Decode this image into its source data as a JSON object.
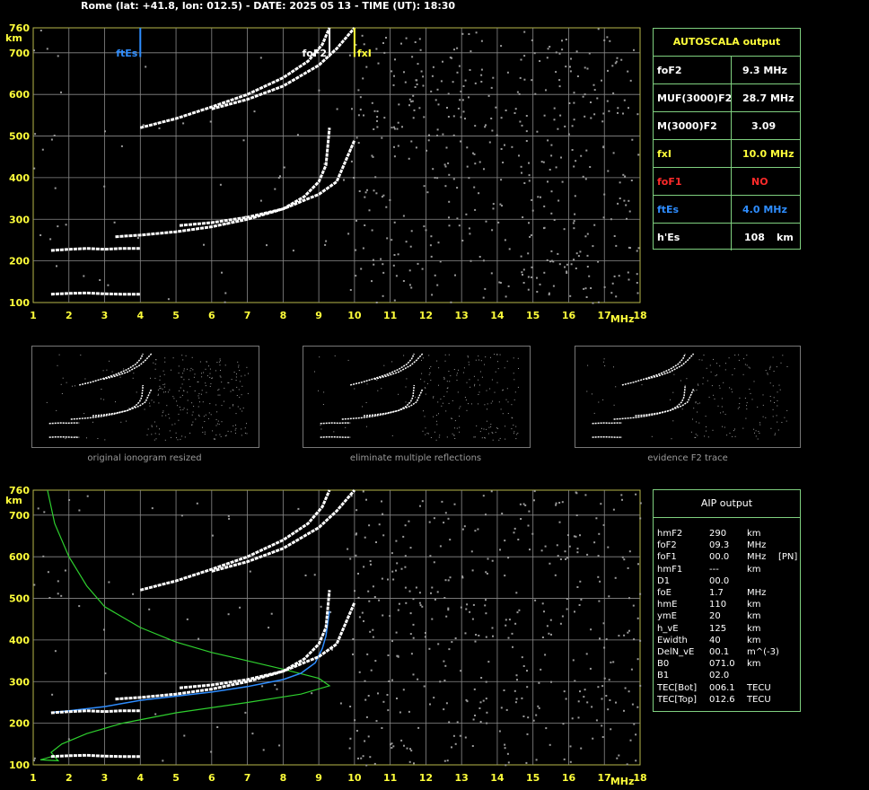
{
  "header": {
    "title": "Rome (lat: +41.8, lon: 012.5) - DATE: 2025 05 13 - TIME (UT): 18:30"
  },
  "colors": {
    "frame": "#b8b84a",
    "grid": "#8a8a8a",
    "yellow": "#ffff3a",
    "red": "#ff2a2a",
    "blue": "#2e8dff",
    "green": "#2ecf2e",
    "trace": "#ffffff",
    "dots": "#9a9a9a",
    "panel_border": "#7fd07f"
  },
  "top_plot": {
    "unit_y": "km",
    "unit_x": "MHz",
    "y_ticks": [
      "760",
      "700",
      "600",
      "500",
      "400",
      "300",
      "200",
      "100"
    ],
    "x_ticks": [
      "1",
      "2",
      "3",
      "4",
      "5",
      "6",
      "7",
      "8",
      "9",
      "10",
      "11",
      "12",
      "13",
      "14",
      "15",
      "16",
      "17",
      "18"
    ],
    "markers": [
      {
        "label": "ftEs",
        "freq": 4.0,
        "color": "blue"
      },
      {
        "label": "foF2",
        "freq": 9.3,
        "color": "white"
      },
      {
        "label": "fxI",
        "freq": 10.0,
        "color": "yellow"
      }
    ]
  },
  "chart_data": [
    {
      "type": "scatter",
      "title": "",
      "xlabel": "MHz",
      "ylabel": "km",
      "xlim": [
        1,
        18
      ],
      "ylim": [
        100,
        760
      ],
      "grid": true,
      "series": [
        {
          "values": [
            [
              1.5,
              120
            ],
            [
              2,
              122
            ],
            [
              2.5,
              123
            ],
            [
              3,
              121
            ],
            [
              3.5,
              120
            ],
            [
              4,
              120
            ]
          ]
        },
        {
          "values": [
            [
              1.5,
              225
            ],
            [
              2,
              228
            ],
            [
              2.5,
              230
            ],
            [
              3,
              228
            ],
            [
              3.5,
              230
            ],
            [
              4,
              230
            ]
          ]
        },
        {
          "values": [
            [
              3.3,
              258
            ],
            [
              4,
              262
            ],
            [
              5,
              270
            ],
            [
              6,
              282
            ],
            [
              7,
              300
            ],
            [
              8,
              325
            ],
            [
              8.6,
              355
            ],
            [
              9,
              390
            ],
            [
              9.2,
              430
            ],
            [
              9.3,
              520
            ]
          ]
        },
        {
          "values": [
            [
              5.1,
              285
            ],
            [
              6,
              292
            ],
            [
              7,
              305
            ],
            [
              8,
              325
            ],
            [
              9,
              360
            ],
            [
              9.5,
              390
            ],
            [
              10,
              490
            ]
          ]
        },
        {
          "values": [
            [
              4,
              520
            ],
            [
              5,
              542
            ],
            [
              6,
              570
            ],
            [
              7,
              600
            ],
            [
              8,
              640
            ],
            [
              8.7,
              680
            ],
            [
              9.1,
              720
            ],
            [
              9.3,
              760
            ]
          ]
        },
        {
          "values": [
            [
              6,
              565
            ],
            [
              7,
              588
            ],
            [
              8,
              620
            ],
            [
              9,
              670
            ],
            [
              9.5,
              710
            ],
            [
              10,
              760
            ]
          ]
        }
      ]
    },
    {
      "type": "line",
      "title": "",
      "xlabel": "MHz",
      "ylabel": "km",
      "xlim": [
        1,
        18
      ],
      "ylim": [
        100,
        760
      ],
      "grid": true,
      "series": [
        {
          "color": "green",
          "values": [
            [
              1.4,
              760
            ],
            [
              1.6,
              680
            ],
            [
              2,
              600
            ],
            [
              2.5,
              530
            ],
            [
              3,
              480
            ],
            [
              4,
              430
            ],
            [
              5,
              395
            ],
            [
              6,
              370
            ],
            [
              7,
              350
            ],
            [
              8,
              330
            ],
            [
              9,
              308
            ],
            [
              9.3,
              290
            ],
            [
              8.5,
              270
            ],
            [
              7,
              250
            ],
            [
              5,
              225
            ],
            [
              3.5,
              200
            ],
            [
              2.5,
              175
            ],
            [
              1.8,
              150
            ],
            [
              1.5,
              130
            ],
            [
              1.7,
              110
            ],
            [
              1.2,
              112
            ],
            [
              1.6,
              122
            ]
          ]
        },
        {
          "color": "blue",
          "values": [
            [
              1.5,
              226
            ],
            [
              2,
              230
            ],
            [
              3,
              240
            ],
            [
              4,
              255
            ],
            [
              5,
              265
            ],
            [
              6,
              275
            ],
            [
              7,
              288
            ],
            [
              8,
              305
            ],
            [
              8.5,
              320
            ],
            [
              8.9,
              345
            ],
            [
              9.1,
              380
            ],
            [
              9.2,
              410
            ],
            [
              9.3,
              470
            ]
          ]
        },
        {
          "values": [
            [
              1.5,
              120
            ],
            [
              2,
              122
            ],
            [
              2.5,
              123
            ],
            [
              3,
              121
            ],
            [
              3.5,
              120
            ],
            [
              4,
              120
            ]
          ]
        },
        {
          "values": [
            [
              1.5,
              225
            ],
            [
              2,
              228
            ],
            [
              2.5,
              230
            ],
            [
              3,
              228
            ],
            [
              3.5,
              230
            ],
            [
              4,
              230
            ]
          ]
        },
        {
          "values": [
            [
              3.3,
              258
            ],
            [
              4,
              262
            ],
            [
              5,
              270
            ],
            [
              6,
              282
            ],
            [
              7,
              300
            ],
            [
              8,
              325
            ],
            [
              8.6,
              355
            ],
            [
              9,
              390
            ],
            [
              9.2,
              430
            ],
            [
              9.3,
              520
            ]
          ]
        },
        {
          "values": [
            [
              5.1,
              285
            ],
            [
              6,
              292
            ],
            [
              7,
              305
            ],
            [
              8,
              325
            ],
            [
              9,
              360
            ],
            [
              9.5,
              390
            ],
            [
              10,
              490
            ]
          ]
        },
        {
          "values": [
            [
              4,
              520
            ],
            [
              5,
              542
            ],
            [
              6,
              570
            ],
            [
              7,
              600
            ],
            [
              8,
              640
            ],
            [
              8.7,
              680
            ],
            [
              9.1,
              720
            ],
            [
              9.3,
              760
            ]
          ]
        },
        {
          "values": [
            [
              6,
              565
            ],
            [
              7,
              588
            ],
            [
              8,
              620
            ],
            [
              9,
              670
            ],
            [
              9.5,
              710
            ],
            [
              10,
              760
            ]
          ]
        }
      ]
    }
  ],
  "thumbnails": [
    {
      "caption": "original ionogram resized"
    },
    {
      "caption": "eliminate multiple reflections"
    },
    {
      "caption": "evidence F2 trace"
    }
  ],
  "autoscala": {
    "title": "AUTOSCALA output",
    "rows": [
      {
        "label": "foF2",
        "value": "9.3 MHz",
        "color": "white"
      },
      {
        "label": "MUF(3000)F2",
        "value": "28.7 MHz",
        "color": "white"
      },
      {
        "label": "M(3000)F2",
        "value": "3.09",
        "color": "white"
      },
      {
        "label": "fxI",
        "value": "10.0 MHz",
        "color": "yellow"
      },
      {
        "label": "foF1",
        "value": "NO",
        "color": "red"
      },
      {
        "label": "ftEs",
        "value": "4.0 MHz",
        "color": "blue"
      },
      {
        "label": "h'Es",
        "value": "108",
        "unit": "km",
        "color": "white"
      }
    ]
  },
  "aip": {
    "title": "AIP output",
    "rows": [
      {
        "name": "hmF2",
        "value": "290",
        "unit": "km",
        "extra": ""
      },
      {
        "name": "foF2",
        "value": "09.3",
        "unit": "MHz",
        "extra": ""
      },
      {
        "name": "foF1",
        "value": "00.0",
        "unit": "MHz",
        "extra": "[PN]"
      },
      {
        "name": "hmF1",
        "value": "---",
        "unit": "km",
        "extra": ""
      },
      {
        "name": "D1",
        "value": "00.0",
        "unit": "",
        "extra": ""
      },
      {
        "name": "foE",
        "value": "1.7",
        "unit": "MHz",
        "extra": ""
      },
      {
        "name": "hmE",
        "value": "110",
        "unit": "km",
        "extra": ""
      },
      {
        "name": "ymE",
        "value": "20",
        "unit": "km",
        "extra": ""
      },
      {
        "name": "h_vE",
        "value": "125",
        "unit": "km",
        "extra": ""
      },
      {
        "name": "Ewidth",
        "value": "40",
        "unit": "km",
        "extra": ""
      },
      {
        "name": "DelN_vE",
        "value": "00.1",
        "unit": "m^(-3)",
        "extra": ""
      },
      {
        "name": "B0",
        "value": "071.0",
        "unit": "km",
        "extra": ""
      },
      {
        "name": "B1",
        "value": "02.0",
        "unit": "",
        "extra": ""
      },
      {
        "name": "TEC[Bot]",
        "value": "006.1",
        "unit": "TECU",
        "extra": ""
      },
      {
        "name": "TEC[Top]",
        "value": "012.6",
        "unit": "TECU",
        "extra": ""
      }
    ]
  }
}
